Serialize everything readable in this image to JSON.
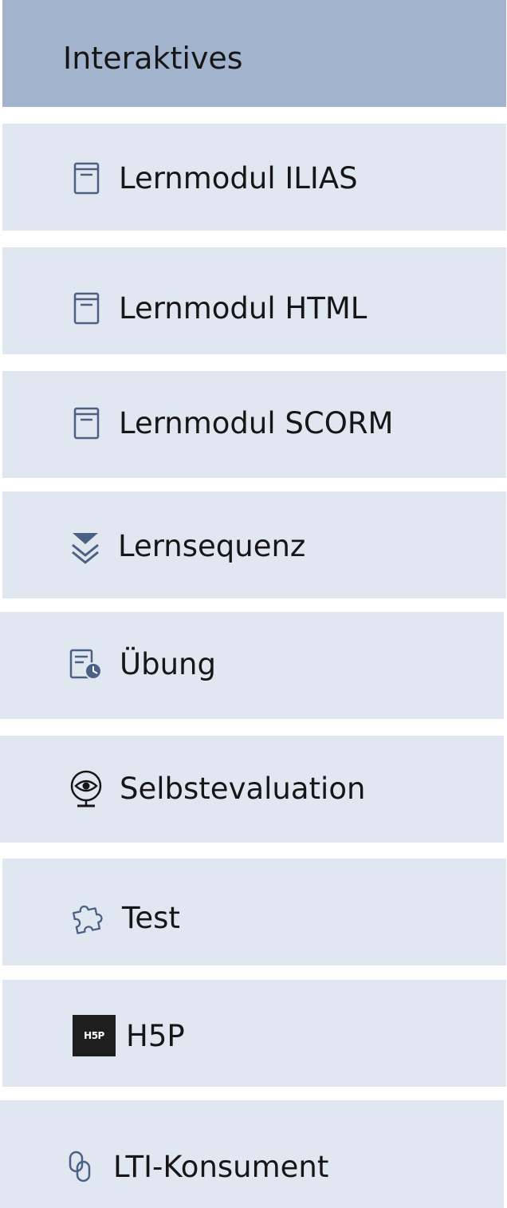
{
  "menu": {
    "header": "Interaktives",
    "items": [
      {
        "label": "Lernmodul ILIAS",
        "icon": "learning-module-icon"
      },
      {
        "label": "Lernmodul HTML",
        "icon": "learning-module-icon"
      },
      {
        "label": "Lernmodul SCORM",
        "icon": "learning-module-icon"
      },
      {
        "label": "Lernsequenz",
        "icon": "learning-sequence-icon"
      },
      {
        "label": "Übung",
        "icon": "exercise-icon"
      },
      {
        "label": "Selbstevaluation",
        "icon": "self-evaluation-icon"
      },
      {
        "label": "Test",
        "icon": "test-puzzle-icon"
      },
      {
        "label": "H5P",
        "icon": "h5p-icon",
        "badge_text": "H5P"
      },
      {
        "label": "LTI-Konsument",
        "icon": "lti-consumer-icon"
      }
    ]
  },
  "colors": {
    "header_bg": "#a2b3cd",
    "item_bg": "#e1e7f0",
    "icon": "#4b6184",
    "text": "#161616"
  }
}
